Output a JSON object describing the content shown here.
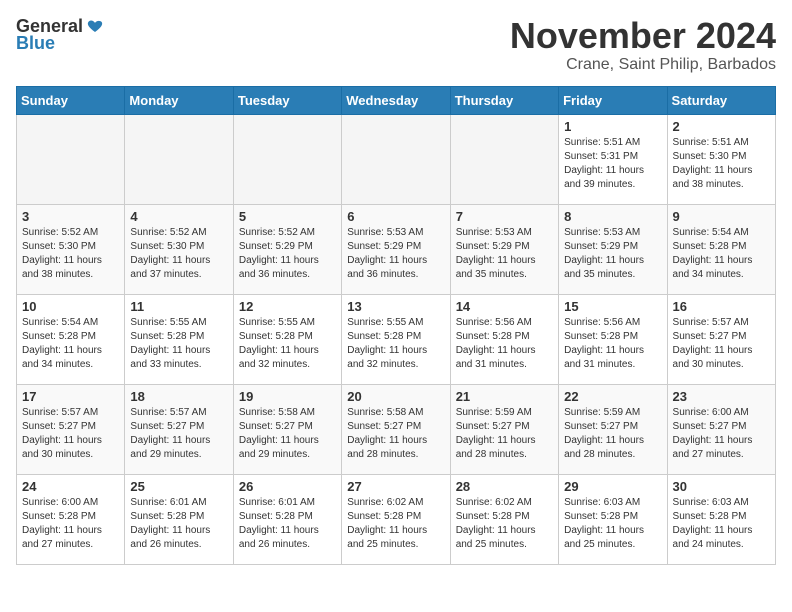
{
  "header": {
    "logo_general": "General",
    "logo_blue": "Blue",
    "month": "November 2024",
    "location": "Crane, Saint Philip, Barbados"
  },
  "weekdays": [
    "Sunday",
    "Monday",
    "Tuesday",
    "Wednesday",
    "Thursday",
    "Friday",
    "Saturday"
  ],
  "weeks": [
    [
      {
        "day": "",
        "info": ""
      },
      {
        "day": "",
        "info": ""
      },
      {
        "day": "",
        "info": ""
      },
      {
        "day": "",
        "info": ""
      },
      {
        "day": "",
        "info": ""
      },
      {
        "day": "1",
        "info": "Sunrise: 5:51 AM\nSunset: 5:31 PM\nDaylight: 11 hours and 39 minutes."
      },
      {
        "day": "2",
        "info": "Sunrise: 5:51 AM\nSunset: 5:30 PM\nDaylight: 11 hours and 38 minutes."
      }
    ],
    [
      {
        "day": "3",
        "info": "Sunrise: 5:52 AM\nSunset: 5:30 PM\nDaylight: 11 hours and 38 minutes."
      },
      {
        "day": "4",
        "info": "Sunrise: 5:52 AM\nSunset: 5:30 PM\nDaylight: 11 hours and 37 minutes."
      },
      {
        "day": "5",
        "info": "Sunrise: 5:52 AM\nSunset: 5:29 PM\nDaylight: 11 hours and 36 minutes."
      },
      {
        "day": "6",
        "info": "Sunrise: 5:53 AM\nSunset: 5:29 PM\nDaylight: 11 hours and 36 minutes."
      },
      {
        "day": "7",
        "info": "Sunrise: 5:53 AM\nSunset: 5:29 PM\nDaylight: 11 hours and 35 minutes."
      },
      {
        "day": "8",
        "info": "Sunrise: 5:53 AM\nSunset: 5:29 PM\nDaylight: 11 hours and 35 minutes."
      },
      {
        "day": "9",
        "info": "Sunrise: 5:54 AM\nSunset: 5:28 PM\nDaylight: 11 hours and 34 minutes."
      }
    ],
    [
      {
        "day": "10",
        "info": "Sunrise: 5:54 AM\nSunset: 5:28 PM\nDaylight: 11 hours and 34 minutes."
      },
      {
        "day": "11",
        "info": "Sunrise: 5:55 AM\nSunset: 5:28 PM\nDaylight: 11 hours and 33 minutes."
      },
      {
        "day": "12",
        "info": "Sunrise: 5:55 AM\nSunset: 5:28 PM\nDaylight: 11 hours and 32 minutes."
      },
      {
        "day": "13",
        "info": "Sunrise: 5:55 AM\nSunset: 5:28 PM\nDaylight: 11 hours and 32 minutes."
      },
      {
        "day": "14",
        "info": "Sunrise: 5:56 AM\nSunset: 5:28 PM\nDaylight: 11 hours and 31 minutes."
      },
      {
        "day": "15",
        "info": "Sunrise: 5:56 AM\nSunset: 5:28 PM\nDaylight: 11 hours and 31 minutes."
      },
      {
        "day": "16",
        "info": "Sunrise: 5:57 AM\nSunset: 5:27 PM\nDaylight: 11 hours and 30 minutes."
      }
    ],
    [
      {
        "day": "17",
        "info": "Sunrise: 5:57 AM\nSunset: 5:27 PM\nDaylight: 11 hours and 30 minutes."
      },
      {
        "day": "18",
        "info": "Sunrise: 5:57 AM\nSunset: 5:27 PM\nDaylight: 11 hours and 29 minutes."
      },
      {
        "day": "19",
        "info": "Sunrise: 5:58 AM\nSunset: 5:27 PM\nDaylight: 11 hours and 29 minutes."
      },
      {
        "day": "20",
        "info": "Sunrise: 5:58 AM\nSunset: 5:27 PM\nDaylight: 11 hours and 28 minutes."
      },
      {
        "day": "21",
        "info": "Sunrise: 5:59 AM\nSunset: 5:27 PM\nDaylight: 11 hours and 28 minutes."
      },
      {
        "day": "22",
        "info": "Sunrise: 5:59 AM\nSunset: 5:27 PM\nDaylight: 11 hours and 28 minutes."
      },
      {
        "day": "23",
        "info": "Sunrise: 6:00 AM\nSunset: 5:27 PM\nDaylight: 11 hours and 27 minutes."
      }
    ],
    [
      {
        "day": "24",
        "info": "Sunrise: 6:00 AM\nSunset: 5:28 PM\nDaylight: 11 hours and 27 minutes."
      },
      {
        "day": "25",
        "info": "Sunrise: 6:01 AM\nSunset: 5:28 PM\nDaylight: 11 hours and 26 minutes."
      },
      {
        "day": "26",
        "info": "Sunrise: 6:01 AM\nSunset: 5:28 PM\nDaylight: 11 hours and 26 minutes."
      },
      {
        "day": "27",
        "info": "Sunrise: 6:02 AM\nSunset: 5:28 PM\nDaylight: 11 hours and 25 minutes."
      },
      {
        "day": "28",
        "info": "Sunrise: 6:02 AM\nSunset: 5:28 PM\nDaylight: 11 hours and 25 minutes."
      },
      {
        "day": "29",
        "info": "Sunrise: 6:03 AM\nSunset: 5:28 PM\nDaylight: 11 hours and 25 minutes."
      },
      {
        "day": "30",
        "info": "Sunrise: 6:03 AM\nSunset: 5:28 PM\nDaylight: 11 hours and 24 minutes."
      }
    ]
  ]
}
